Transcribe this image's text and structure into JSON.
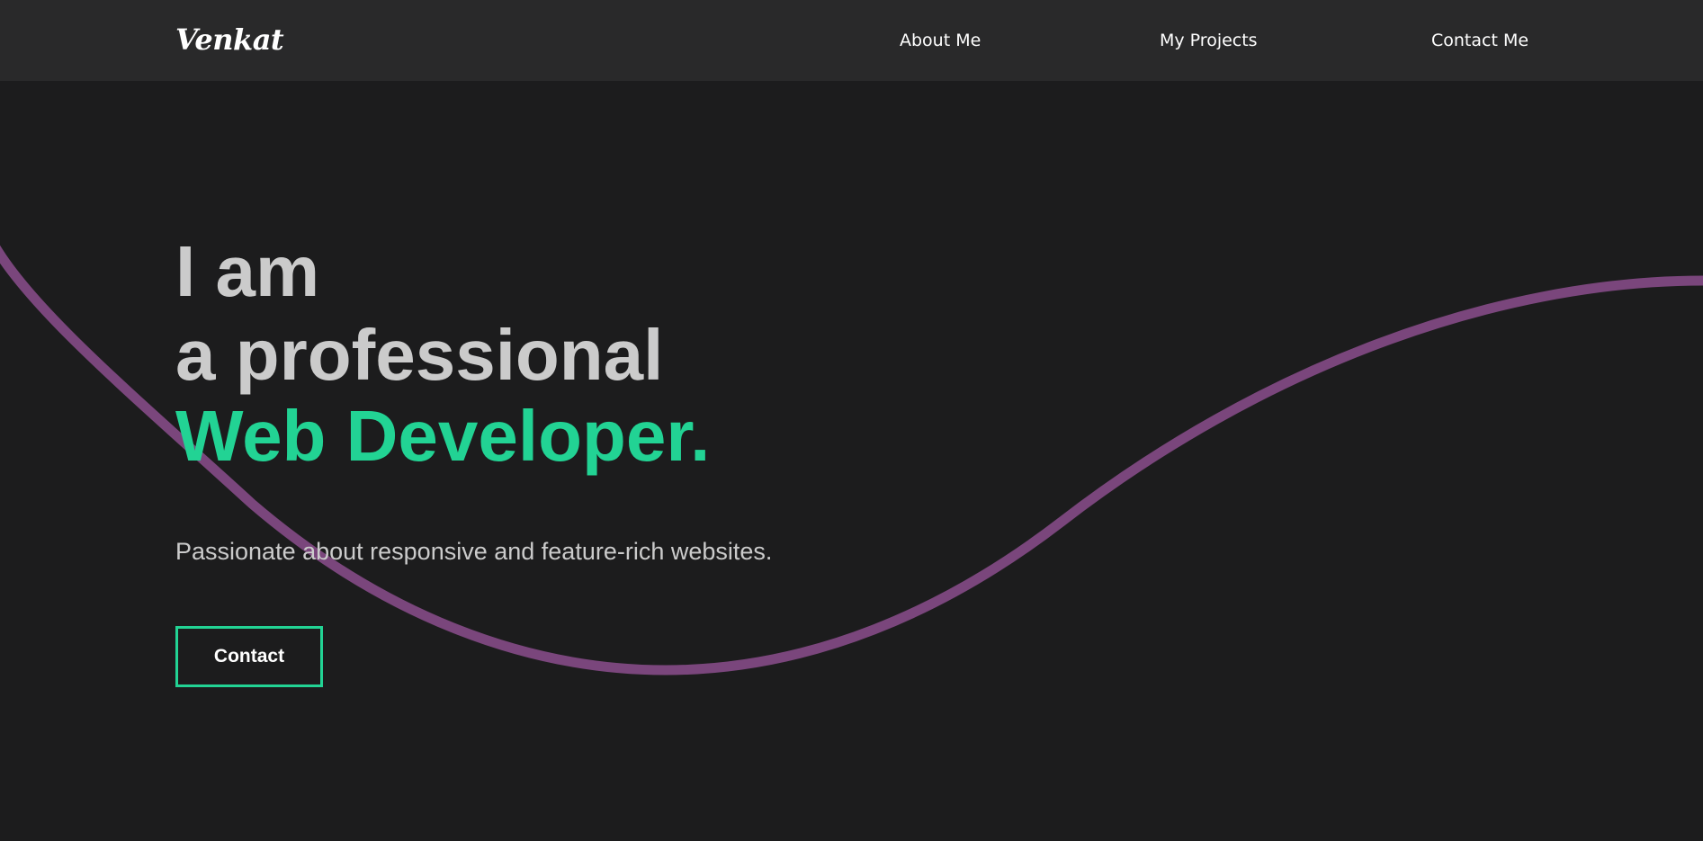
{
  "brand": {
    "logo_text": "Venkat"
  },
  "nav": {
    "items": [
      {
        "label": "About Me"
      },
      {
        "label": "My Projects"
      },
      {
        "label": "Contact Me"
      }
    ]
  },
  "hero": {
    "line1": "I am",
    "line2": "a professional",
    "highlight": "Web Developer.",
    "tagline": "Passionate about responsive and feature-rich websites.",
    "button_label": "Contact"
  },
  "colors": {
    "background": "#1c1c1d",
    "navbar": "#29292a",
    "accent": "#22d394",
    "wave": "#7a467c",
    "text_light": "#cbcbcb"
  }
}
